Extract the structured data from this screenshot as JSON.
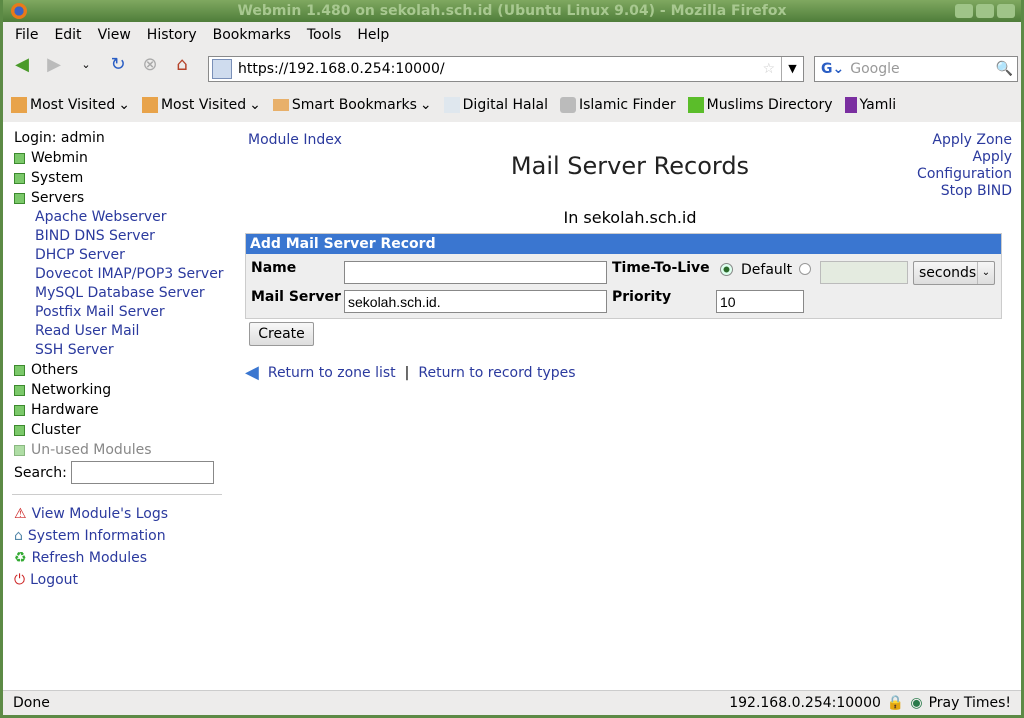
{
  "window": {
    "title": "Webmin 1.480 on sekolah.sch.id (Ubuntu Linux 9.04) - Mozilla Firefox"
  },
  "menu": [
    "File",
    "Edit",
    "View",
    "History",
    "Bookmarks",
    "Tools",
    "Help"
  ],
  "nav": {
    "url": "https://192.168.0.254:10000/",
    "search_placeholder": "Google"
  },
  "bookmarks": [
    "Most Visited",
    "Most Visited",
    "Smart Bookmarks",
    "Digital Halal",
    "Islamic Finder",
    "Muslims Directory",
    "Yamli"
  ],
  "sidebar": {
    "login": "Login: admin",
    "cats_top": [
      "Webmin",
      "System",
      "Servers"
    ],
    "modules": [
      "Apache Webserver",
      "BIND DNS Server",
      "DHCP Server",
      "Dovecot IMAP/POP3 Server",
      "MySQL Database Server",
      "Postfix Mail Server",
      "Read User Mail",
      "SSH Server"
    ],
    "cats_bottom": [
      "Others",
      "Networking",
      "Hardware",
      "Cluster",
      "Un-used Modules"
    ],
    "search_label": "Search:",
    "links": [
      "View Module's Logs",
      "System Information",
      "Refresh Modules",
      "Logout"
    ]
  },
  "main": {
    "module_index": "Module Index",
    "title": "Mail Server Records",
    "subtitle": "In sekolah.sch.id",
    "right_links": [
      "Apply Zone",
      "Apply",
      "Configuration",
      "Stop BIND"
    ],
    "form": {
      "header": "Add Mail Server Record",
      "name_label": "Name",
      "name_value": "",
      "ttl_label": "Time-To-Live",
      "ttl_default": "Default",
      "ttl_unit": "seconds",
      "mail_label": "Mail Server",
      "mail_value": "sekolah.sch.id.",
      "priority_label": "Priority",
      "priority_value": "10",
      "create": "Create"
    },
    "return_zone": "Return to zone list",
    "sep": "|",
    "return_types": "Return to record types"
  },
  "status": {
    "left": "Done",
    "host": "192.168.0.254:10000",
    "pray": "Pray Times!"
  }
}
